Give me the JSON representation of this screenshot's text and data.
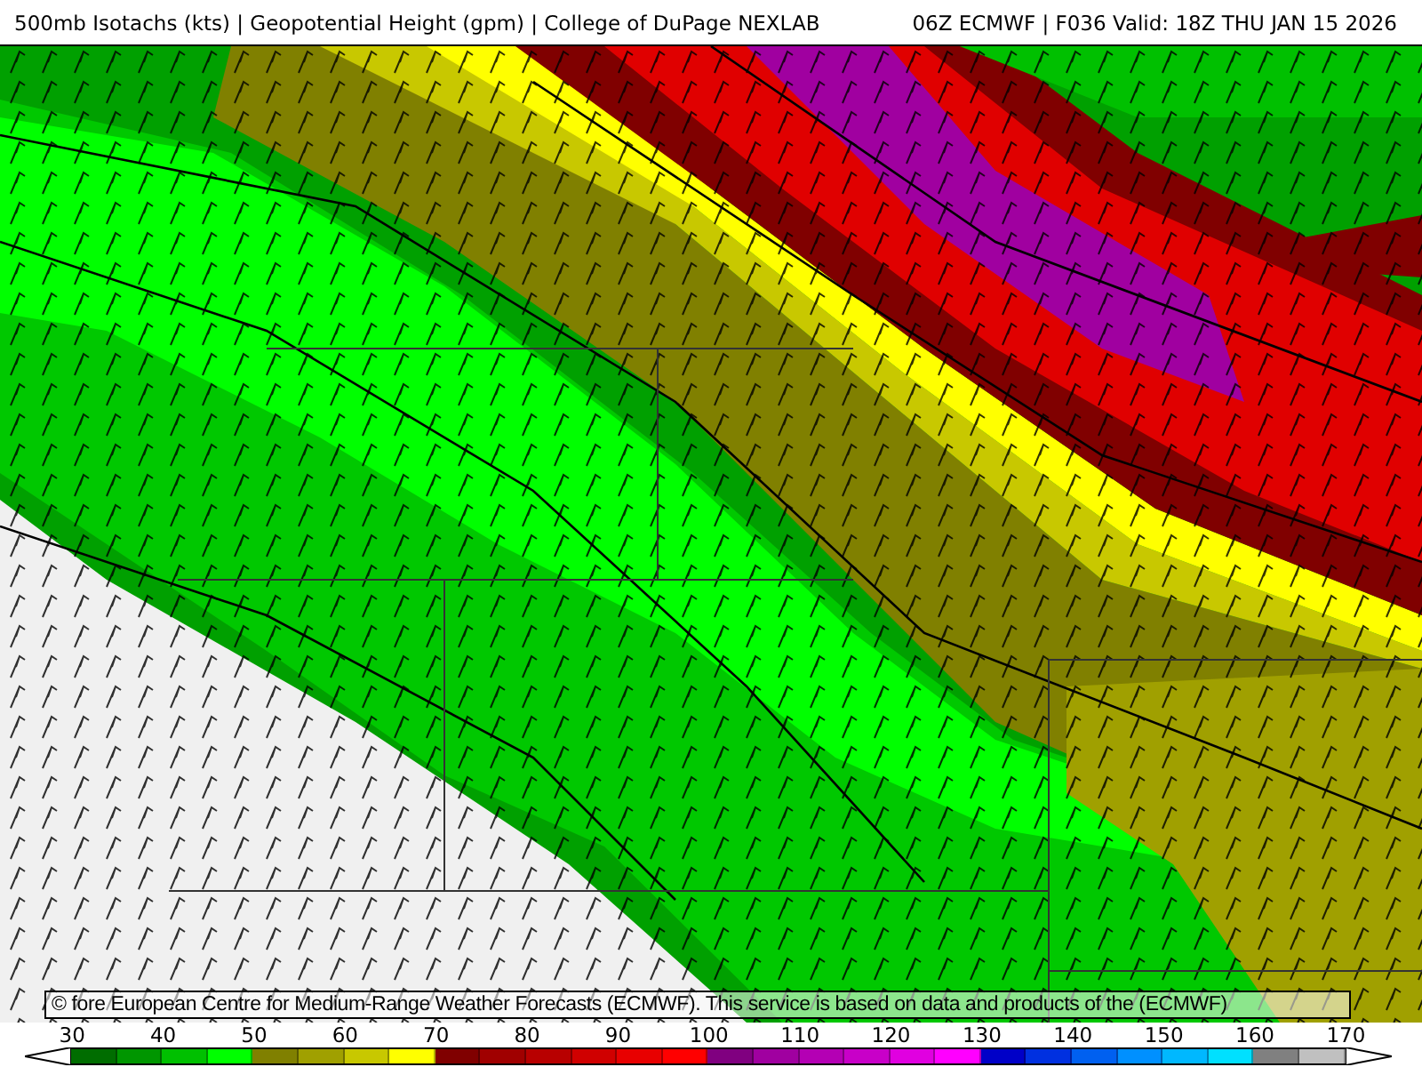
{
  "header": {
    "title": "500mb Isotachs (kts) | Geopotential Height (gpm) | College of DuPage NEXLAB",
    "run": "06Z ECMWF | F036 Valid: 18Z THU JAN 15 2026"
  },
  "map": {
    "credit": "© fore European Centre for Medium-Range Weather Forecasts (ECMWF). This service is based on data and products of the (ECMWF)"
  },
  "legend": {
    "labels": [
      "30",
      "40",
      "50",
      "60",
      "70",
      "80",
      "90",
      "100",
      "110",
      "120",
      "130",
      "140",
      "150",
      "160",
      "170"
    ],
    "bins": [
      {
        "color": "#006d00"
      },
      {
        "color": "#009600"
      },
      {
        "color": "#00c000"
      },
      {
        "color": "#00ff00"
      },
      {
        "color": "#808000"
      },
      {
        "color": "#a0a000"
      },
      {
        "color": "#c8c800"
      },
      {
        "color": "#ffff00"
      },
      {
        "color": "#800000"
      },
      {
        "color": "#a00000"
      },
      {
        "color": "#b80000"
      },
      {
        "color": "#d00000"
      },
      {
        "color": "#e80000"
      },
      {
        "color": "#ff0000"
      },
      {
        "color": "#800080"
      },
      {
        "color": "#a000a0"
      },
      {
        "color": "#b400b4"
      },
      {
        "color": "#c800c8"
      },
      {
        "color": "#e000e0"
      },
      {
        "color": "#ff00ff"
      },
      {
        "color": "#0000c8"
      },
      {
        "color": "#0030e0"
      },
      {
        "color": "#0060f0"
      },
      {
        "color": "#0090ff"
      },
      {
        "color": "#00b8ff"
      },
      {
        "color": "#00e0ff"
      },
      {
        "color": "#808080"
      },
      {
        "color": "#c0c0c0"
      }
    ]
  }
}
